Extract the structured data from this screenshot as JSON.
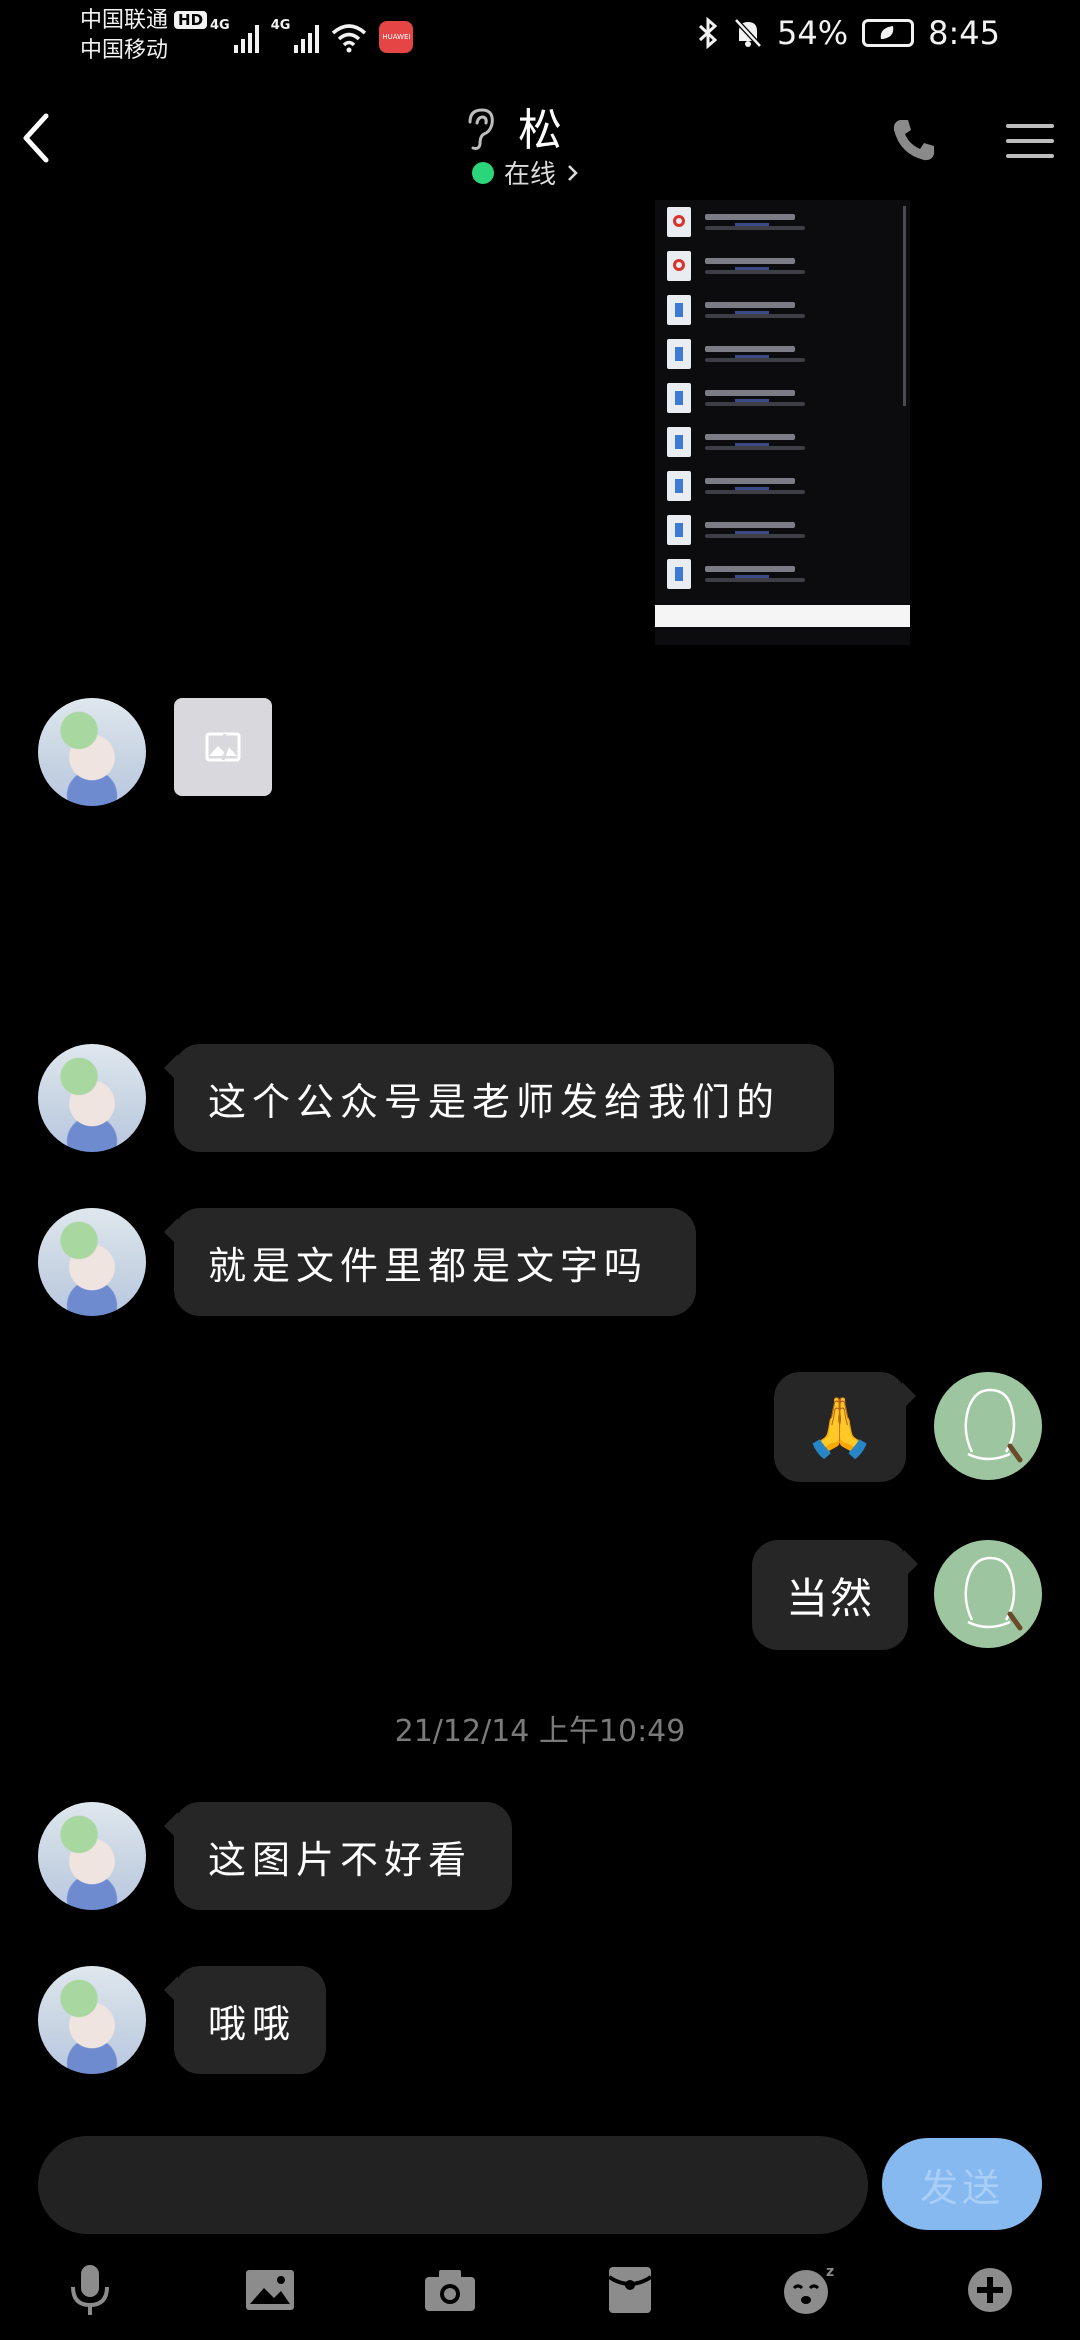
{
  "status_bar": {
    "carrier1": "中国联通",
    "carrier1_badge": "HD",
    "carrier2": "中国移动",
    "net1": "4G",
    "net2": "4G",
    "app_badge": "HUAWEI",
    "battery_percent": "54%",
    "time": "8:45"
  },
  "header": {
    "contact_name": "松",
    "status": "在线"
  },
  "messages": [
    {
      "type": "screenshot",
      "side": "right"
    },
    {
      "type": "broken_image",
      "side": "left"
    },
    {
      "type": "text",
      "side": "left",
      "text": "这个公众号是老师发给我们的"
    },
    {
      "type": "text",
      "side": "left",
      "text": "就是文件里都是文字吗"
    },
    {
      "type": "emoji",
      "side": "right",
      "text": "🙏"
    },
    {
      "type": "text",
      "side": "right",
      "text": "当然"
    },
    {
      "type": "text",
      "side": "left",
      "text": "这图片不好看"
    },
    {
      "type": "text",
      "side": "left",
      "text": "哦哦"
    }
  ],
  "timestamp": "21/12/14 上午10:49",
  "input": {
    "value": "",
    "send_label": "发送"
  },
  "toolbar": {
    "icons": [
      "microphone-icon",
      "image-icon",
      "camera-icon",
      "red-packet-icon",
      "emoji-icon",
      "plus-icon"
    ]
  },
  "colors": {
    "background": "#000000",
    "bubble": "#262626",
    "online": "#2bd67a",
    "send_button": "#86b9f0",
    "timestamp": "#7a7a7a"
  }
}
